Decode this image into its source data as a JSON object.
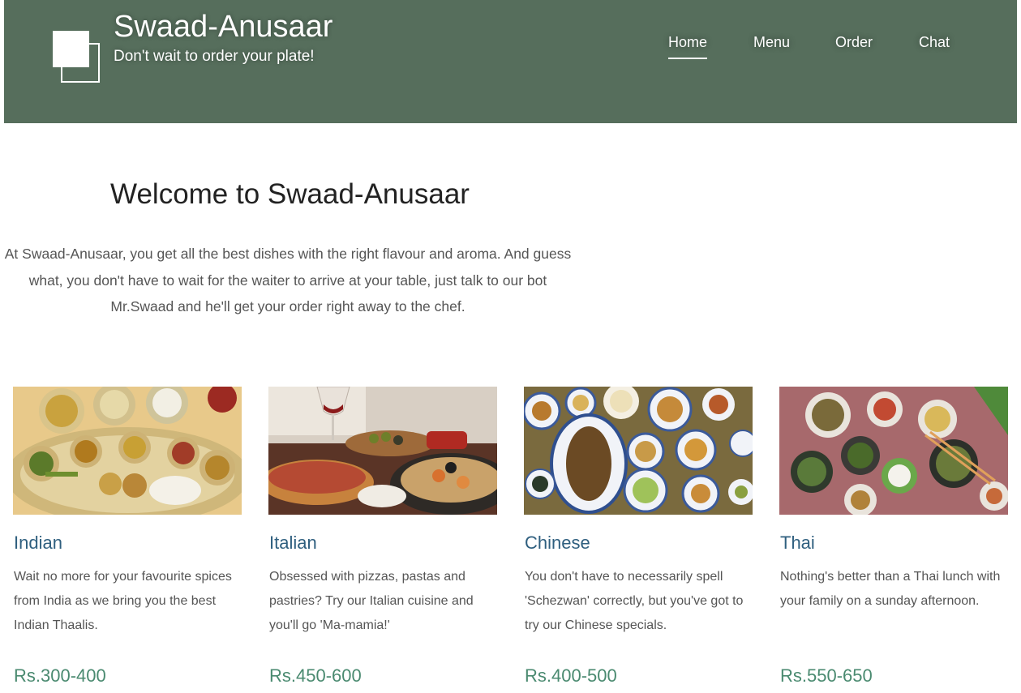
{
  "header": {
    "title": "Swaad-Anusaar",
    "tagline": "Don't wait to order your plate!",
    "nav": [
      {
        "label": "Home",
        "active": true
      },
      {
        "label": "Menu",
        "active": false
      },
      {
        "label": "Order",
        "active": false
      },
      {
        "label": "Chat",
        "active": false
      }
    ]
  },
  "main": {
    "heading": "Welcome to Swaad-Anusaar",
    "intro": "At Swaad-Anusaar, you get all the best dishes with the right flavour and aroma. And guess what, you don't have to wait for the waiter to arrive at your table, just talk to our bot Mr.Swaad and he'll get your order right away to the chef."
  },
  "cards": [
    {
      "name": "Indian",
      "description": "Wait no more for your favourite spices from India as we bring you the best Indian Thaalis.",
      "price": "Rs.300-400",
      "image_icon": "indian-thali-photo"
    },
    {
      "name": "Italian",
      "description": "Obsessed with pizzas, pastas and pastries? Try our Italian cuisine and you'll go 'Ma-mamia!'",
      "price": "Rs.450-600",
      "image_icon": "italian-platter-photo"
    },
    {
      "name": "Chinese",
      "description": "You don't have to necessarily spell 'Schezwan' correctly, but you've got to try our Chinese specials.",
      "price": "Rs.400-500",
      "image_icon": "chinese-dishes-photo"
    },
    {
      "name": "Thai",
      "description": "Nothing's better than a Thai lunch with your family on a sunday afternoon.",
      "price": "Rs.550-650",
      "image_icon": "thai-dishes-photo"
    }
  ],
  "colors": {
    "header_bg": "#566e5c",
    "card_title": "#2f5f7f",
    "price": "#4a8a70",
    "body_text": "#555555"
  }
}
